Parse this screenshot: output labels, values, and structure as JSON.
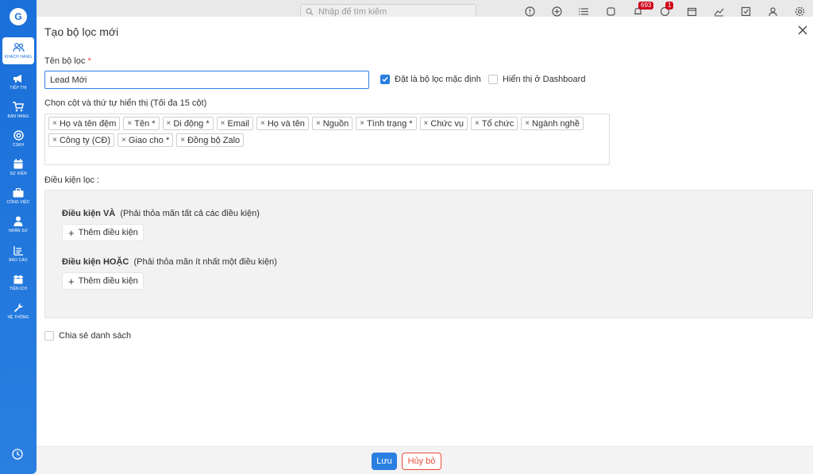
{
  "topbar": {
    "search_placeholder": "Nhập để tìm kiếm",
    "notification_count": "693",
    "chat_count": "1"
  },
  "sidebar": {
    "logo": "G",
    "items": [
      {
        "label": "KHÁCH HÀNG",
        "icon": "users-icon",
        "active": true
      },
      {
        "label": "TIẾP THỊ",
        "icon": "megaphone-icon"
      },
      {
        "label": "BÁN HÀNG",
        "icon": "cart-icon"
      },
      {
        "label": "CSKH",
        "icon": "lifebuoy-icon"
      },
      {
        "label": "SỰ KIỆN",
        "icon": "calendar-icon"
      },
      {
        "label": "CÔNG VIỆC",
        "icon": "briefcase-icon"
      },
      {
        "label": "NHÂN SỰ",
        "icon": "person-icon"
      },
      {
        "label": "BÁO CÁO",
        "icon": "report-icon"
      },
      {
        "label": "TIỆN ÍCH",
        "icon": "box-icon"
      },
      {
        "label": "HỆ THỐNG",
        "icon": "wrench-icon"
      }
    ]
  },
  "modal": {
    "title": "Tạo bộ lọc mới",
    "name_label": "Tên bộ lọc",
    "required_mark": "*",
    "name_value": "Lead Mới",
    "default_label": "Đặt là bộ lọc mặc định",
    "dashboard_label": "Hiển thị ở Dashboard",
    "columns_label": "Chọn cột và thứ tự hiển thị (Tối đa 15 cột)",
    "columns": [
      "Họ và tên đệm",
      "Tên *",
      "Di động *",
      "Email",
      "Họ và tên",
      "Nguồn",
      "Tình trạng *",
      "Chức vụ",
      "Tổ chức",
      "Ngành nghề",
      "Công ty (CĐ)",
      "Giao cho *",
      "Đồng bộ Zalo"
    ],
    "conditions_label": "Điều kiện lọc :",
    "and_title": "Điều kiện VÀ",
    "and_desc": "(Phải thỏa mãn tất cả các điều kiện)",
    "or_title": "Điều kiện HOẶC",
    "or_desc": "(Phải thỏa mãn ít nhất một điều kiện)",
    "add_condition": "Thêm điều kiện",
    "share_label": "Chia sẻ danh sách",
    "save": "Lưu",
    "cancel": "Hủy bỏ"
  }
}
